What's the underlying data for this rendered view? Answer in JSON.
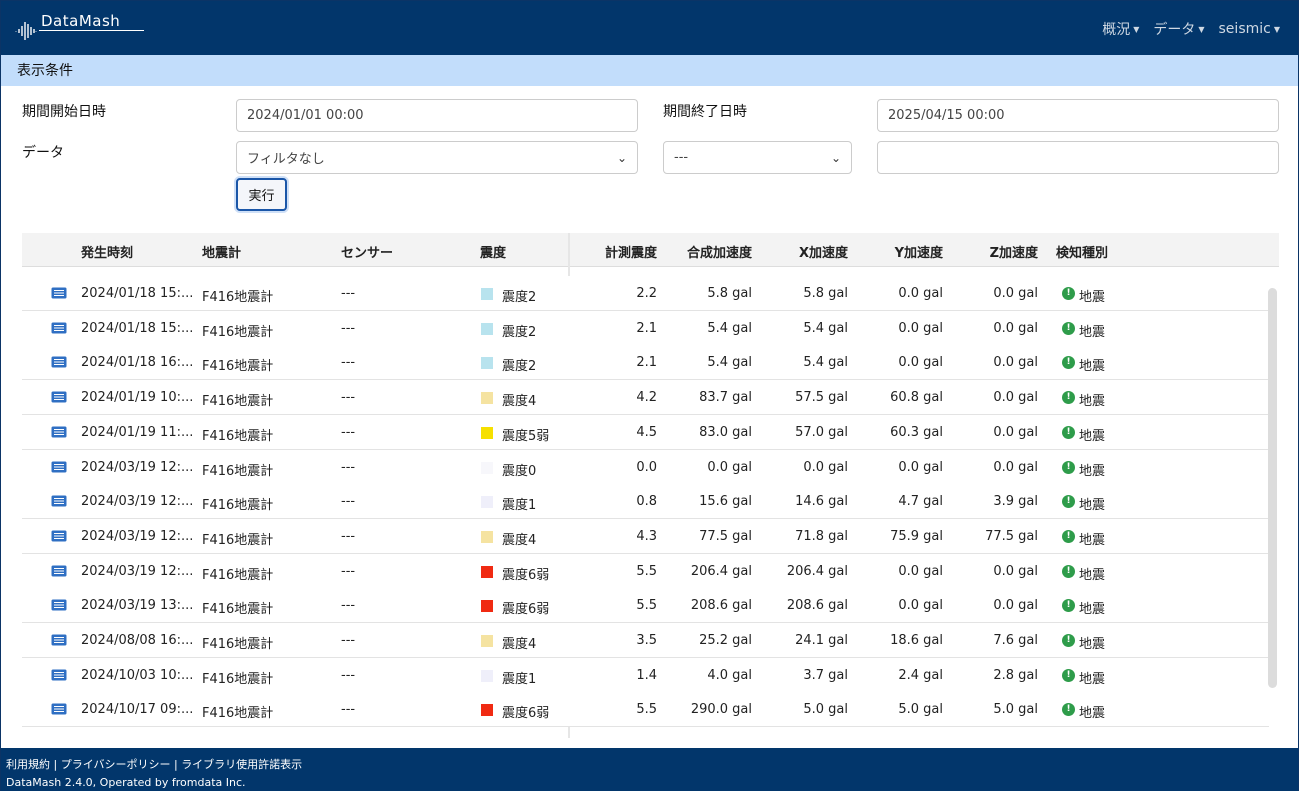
{
  "app": {
    "title": "DataMash"
  },
  "nav": {
    "overview": "概況",
    "data": "データ",
    "user": "seismic"
  },
  "conditions": {
    "section_title": "表示条件",
    "start_label": "期間開始日時",
    "start_value": "2024/01/01 00:00",
    "end_label": "期間終了日時",
    "end_value": "2025/04/15 00:00",
    "data_label": "データ",
    "filter_value": "フィルタなし",
    "sub_select_value": "---",
    "extra_value": "",
    "run_label": "実行"
  },
  "table": {
    "headers": {
      "time": "発生時刻",
      "meter": "地震計",
      "sensor": "センサー",
      "intensity": "震度",
      "measured": "計測震度",
      "combined": "合成加速度",
      "x": "X加速度",
      "y": "Y加速度",
      "z": "Z加速度",
      "type": "検知種別"
    },
    "rows": [
      {
        "time": "2024/01/18 15:...",
        "meter": "F416地震計",
        "sensor": "---",
        "color": "#b8e3ee",
        "intensity": "震度2",
        "measured": "2.2",
        "combined": "5.8 gal",
        "x": "5.8 gal",
        "y": "0.0 gal",
        "z": "0.0 gal",
        "type": "地震"
      },
      {
        "time": "2024/01/18 15:...",
        "meter": "F416地震計",
        "sensor": "---",
        "color": "#b8e3ee",
        "intensity": "震度2",
        "measured": "2.1",
        "combined": "5.4 gal",
        "x": "5.4 gal",
        "y": "0.0 gal",
        "z": "0.0 gal",
        "type": "地震"
      },
      {
        "time": "2024/01/18 16:...",
        "meter": "F416地震計",
        "sensor": "---",
        "color": "#b8e3ee",
        "intensity": "震度2",
        "measured": "2.1",
        "combined": "5.4 gal",
        "x": "5.4 gal",
        "y": "0.0 gal",
        "z": "0.0 gal",
        "type": "地震"
      },
      {
        "time": "2024/01/19 10:...",
        "meter": "F416地震計",
        "sensor": "---",
        "color": "#f5e3a1",
        "intensity": "震度4",
        "measured": "4.2",
        "combined": "83.7 gal",
        "x": "57.5 gal",
        "y": "60.8 gal",
        "z": "0.0 gal",
        "type": "地震"
      },
      {
        "time": "2024/01/19 11:...",
        "meter": "F416地震計",
        "sensor": "---",
        "color": "#f6e000",
        "intensity": "震度5弱",
        "measured": "4.5",
        "combined": "83.0 gal",
        "x": "57.0 gal",
        "y": "60.3 gal",
        "z": "0.0 gal",
        "type": "地震"
      },
      {
        "time": "2024/03/19 12:...",
        "meter": "F416地震計",
        "sensor": "---",
        "color": "#f7f7fb",
        "intensity": "震度0",
        "measured": "0.0",
        "combined": "0.0 gal",
        "x": "0.0 gal",
        "y": "0.0 gal",
        "z": "0.0 gal",
        "type": "地震"
      },
      {
        "time": "2024/03/19 12:...",
        "meter": "F416地震計",
        "sensor": "---",
        "color": "#efeffa",
        "intensity": "震度1",
        "measured": "0.8",
        "combined": "15.6 gal",
        "x": "14.6 gal",
        "y": "4.7 gal",
        "z": "3.9 gal",
        "type": "地震"
      },
      {
        "time": "2024/03/19 12:...",
        "meter": "F416地震計",
        "sensor": "---",
        "color": "#f5e3a1",
        "intensity": "震度4",
        "measured": "4.3",
        "combined": "77.5 gal",
        "x": "71.8 gal",
        "y": "75.9 gal",
        "z": "77.5 gal",
        "type": "地震"
      },
      {
        "time": "2024/03/19 12:...",
        "meter": "F416地震計",
        "sensor": "---",
        "color": "#f02a12",
        "intensity": "震度6弱",
        "measured": "5.5",
        "combined": "206.4 gal",
        "x": "206.4 gal",
        "y": "0.0 gal",
        "z": "0.0 gal",
        "type": "地震"
      },
      {
        "time": "2024/03/19 13:...",
        "meter": "F416地震計",
        "sensor": "---",
        "color": "#f02a12",
        "intensity": "震度6弱",
        "measured": "5.5",
        "combined": "208.6 gal",
        "x": "208.6 gal",
        "y": "0.0 gal",
        "z": "0.0 gal",
        "type": "地震"
      },
      {
        "time": "2024/08/08 16:...",
        "meter": "F416地震計",
        "sensor": "---",
        "color": "#f5e3a1",
        "intensity": "震度4",
        "measured": "3.5",
        "combined": "25.2 gal",
        "x": "24.1 gal",
        "y": "18.6 gal",
        "z": "7.6 gal",
        "type": "地震"
      },
      {
        "time": "2024/10/03 10:...",
        "meter": "F416地震計",
        "sensor": "---",
        "color": "#efeffa",
        "intensity": "震度1",
        "measured": "1.4",
        "combined": "4.0 gal",
        "x": "3.7 gal",
        "y": "2.4 gal",
        "z": "2.8 gal",
        "type": "地震"
      },
      {
        "time": "2024/10/17 09:...",
        "meter": "F416地震計",
        "sensor": "---",
        "color": "#f02a12",
        "intensity": "震度6弱",
        "measured": "5.5",
        "combined": "290.0 gal",
        "x": "5.0 gal",
        "y": "5.0 gal",
        "z": "5.0 gal",
        "type": "地震"
      }
    ]
  },
  "footer": {
    "terms": "利用規約",
    "privacy": "プライバシーポリシー",
    "licenses": "ライブラリ使用許諾表示",
    "separator": " | ",
    "copyright": "DataMash 2.4.0, Operated by fromdata Inc."
  }
}
